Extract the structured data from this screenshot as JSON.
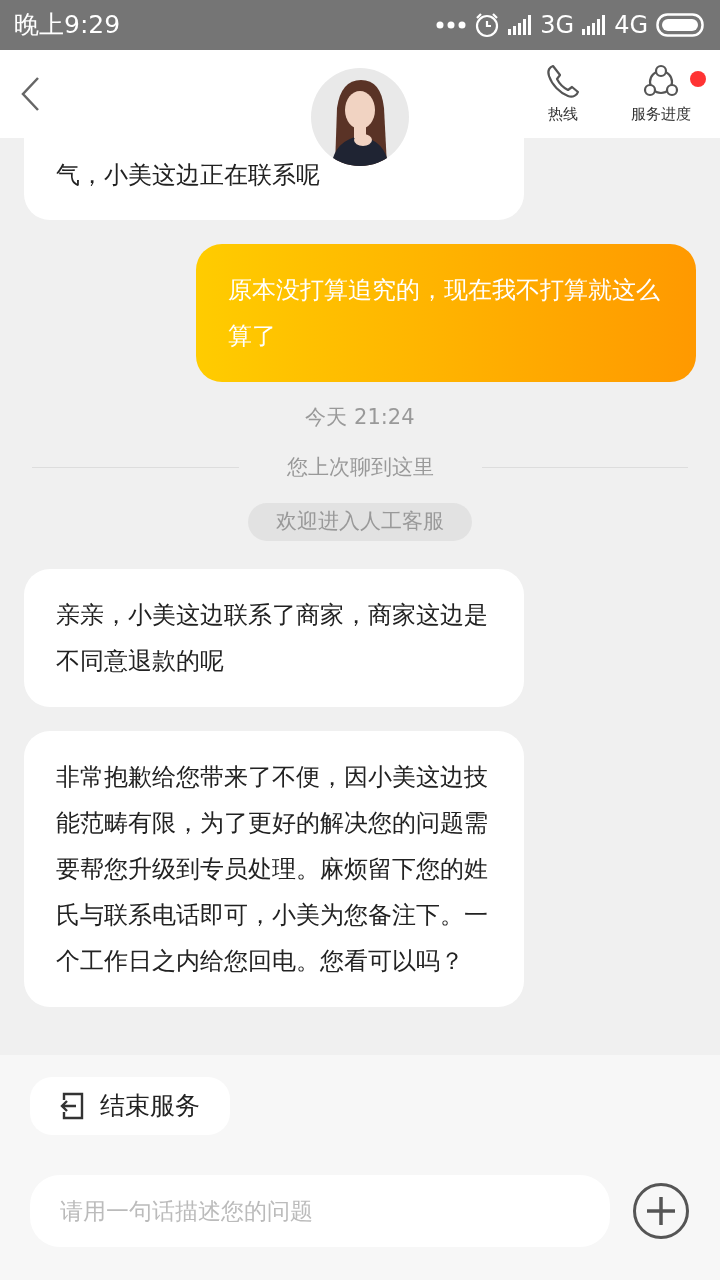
{
  "status_bar": {
    "time": "晚上9:29",
    "networks": [
      "3G",
      "4G"
    ]
  },
  "header": {
    "actions": [
      {
        "kind": "phone",
        "label": "热线",
        "notification": false
      },
      {
        "kind": "progress",
        "label": "服务进度",
        "notification": true
      }
    ]
  },
  "messages": [
    {
      "kind": "agent",
      "text": "气，小美这边正在联系呢",
      "cut": true
    },
    {
      "kind": "user",
      "text": "原本没打算追究的，现在我不打算就这么算了",
      "cut": false
    },
    {
      "kind": "time",
      "text": "今天 21:24"
    },
    {
      "kind": "divider",
      "text": "您上次聊到这里"
    },
    {
      "kind": "notice",
      "text": "欢迎进入人工客服"
    },
    {
      "kind": "agent",
      "text": "亲亲，小美这边联系了商家，商家这边是不同意退款的呢",
      "cut": false
    },
    {
      "kind": "agent",
      "text": "非常抱歉给您带来了不便，因小美这边技能范畴有限，为了更好的解决您的问题需要帮您升级到专员处理。麻烦留下您的姓氏与联系电话即可，小美为您备注下。一个工作日之内给您回电。您看可以吗？",
      "cut": false
    }
  ],
  "quick_actions": [
    {
      "label": "结束服务"
    }
  ],
  "input": {
    "placeholder": "请用一句话描述您的问题"
  }
}
